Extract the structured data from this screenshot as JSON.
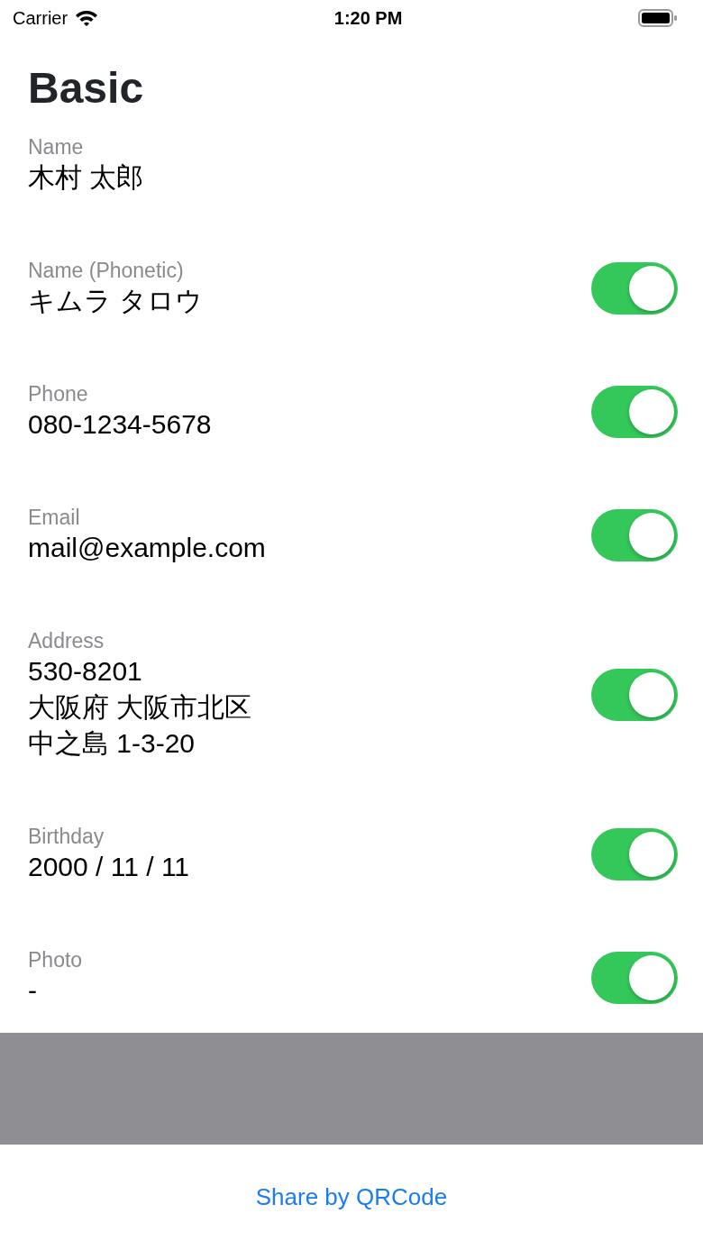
{
  "status_bar": {
    "carrier": "Carrier",
    "time": "1:20 PM"
  },
  "title": "Basic",
  "fields": [
    {
      "label": "Name",
      "lines": [
        "木村 太郎"
      ]
    },
    {
      "label": "Name (Phonetic)",
      "lines": [
        "キムラ タロウ"
      ],
      "on": true
    },
    {
      "label": "Phone",
      "lines": [
        "080-1234-5678"
      ],
      "on": true
    },
    {
      "label": "Email",
      "lines": [
        "mail@example.com"
      ],
      "on": true
    },
    {
      "label": "Address",
      "lines": [
        "530-8201",
        "大阪府 大阪市北区",
        "中之島 1-3-20"
      ],
      "on": true
    },
    {
      "label": "Birthday",
      "lines": [
        "2000 / 11 / 11"
      ],
      "on": true
    },
    {
      "label": "Photo",
      "lines": [
        "-"
      ],
      "on": true
    }
  ],
  "share_button": "Share by QRCode"
}
